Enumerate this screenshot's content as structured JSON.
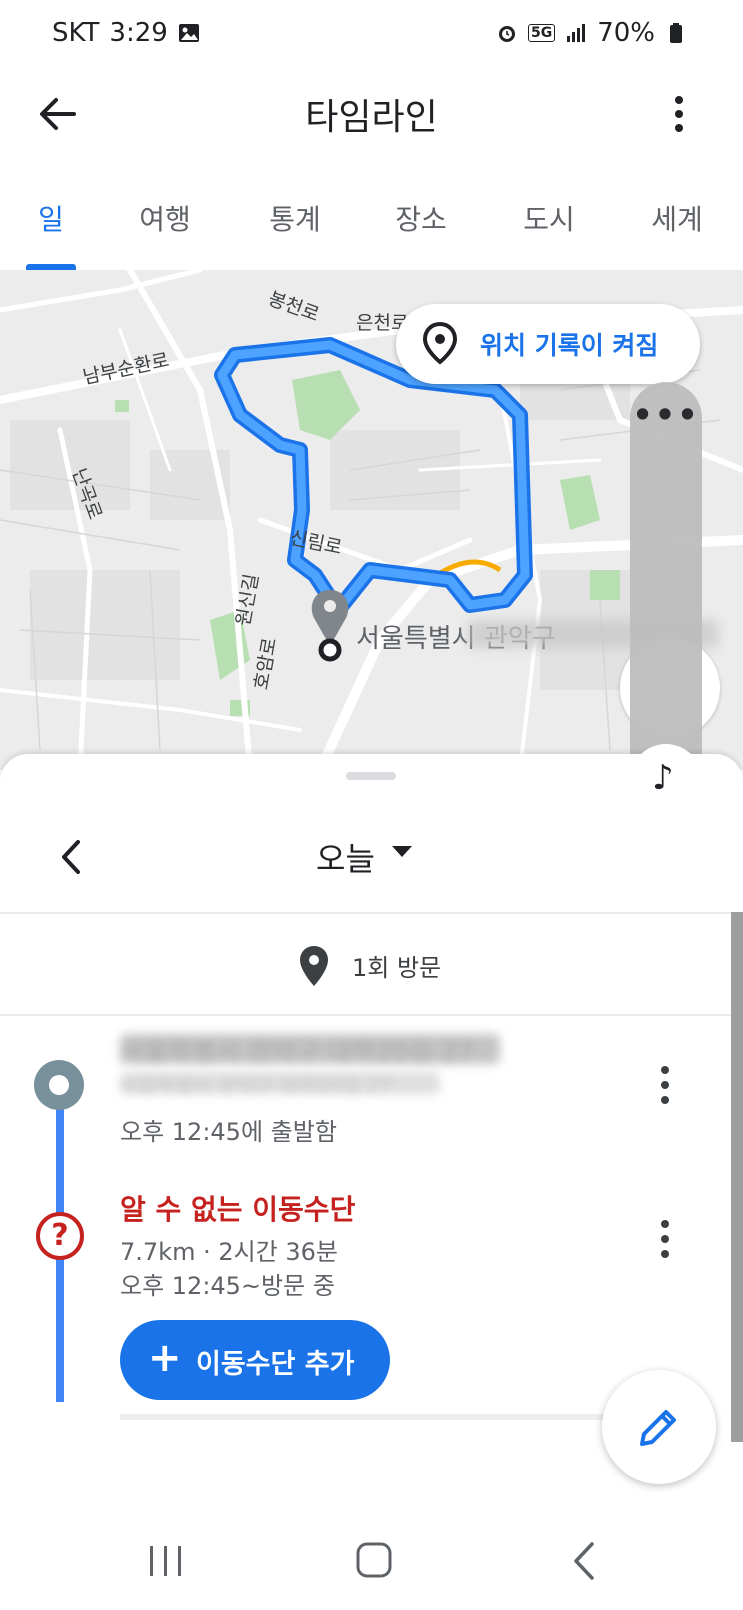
{
  "status_bar": {
    "carrier": "SKT",
    "time": "3:29",
    "network": "5G",
    "battery": "70%"
  },
  "app_bar": {
    "title": "타임라인"
  },
  "tabs": [
    {
      "label": "일",
      "active": true
    },
    {
      "label": "여행",
      "active": false
    },
    {
      "label": "통계",
      "active": false
    },
    {
      "label": "장소",
      "active": false
    },
    {
      "label": "도시",
      "active": false
    },
    {
      "label": "세계",
      "active": false
    }
  ],
  "map": {
    "location_pill": "위치 기록이 켜짐",
    "road_labels": [
      "봉천로",
      "은천로",
      "남부순환로",
      "난곡로",
      "신림로",
      "원신길",
      "호암로"
    ],
    "place_label": "서울특별시 관악구",
    "route_color": "#1a73e8"
  },
  "sheet": {
    "date_label": "오늘",
    "visit_count": "1회 방문",
    "place_name": "서울특별시 관악구 대학20길 27",
    "place_address": "서울특별시 관악구 대학20길 27",
    "depart": "오후 12:45에 출발함",
    "transport_title": "알 수 없는 이동수단",
    "transport_distance": "7.7km · 2시간 36분",
    "transport_time": "오후 12:45~방문 중",
    "add_transport_label": "이동수단 추가",
    "unknown_icon": "?"
  },
  "colors": {
    "accent": "#1a73e8",
    "error": "#c5221f",
    "timeline": "#4285f4"
  }
}
